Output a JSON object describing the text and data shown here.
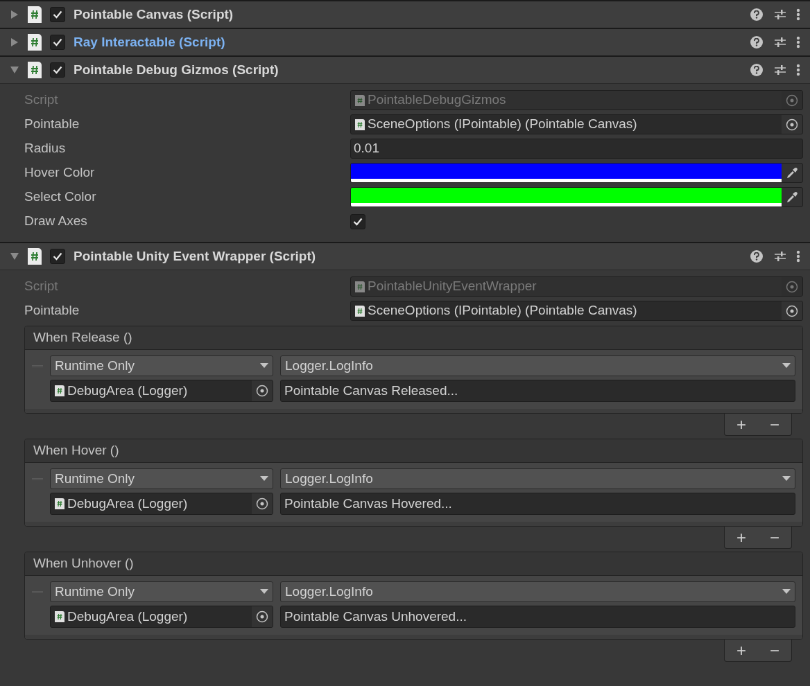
{
  "components": [
    {
      "title": "Pointable Canvas (Script)",
      "expanded": false,
      "enabled": true,
      "highlighted": false
    },
    {
      "title": "Ray Interactable (Script)",
      "expanded": false,
      "enabled": true,
      "highlighted": true
    },
    {
      "title": "Pointable Debug Gizmos (Script)",
      "expanded": true,
      "enabled": true,
      "highlighted": false,
      "fields": [
        {
          "label": "Script",
          "kind": "object",
          "value": "PointableDebugGizmos",
          "disabled": true
        },
        {
          "label": "Pointable",
          "kind": "object",
          "value": "SceneOptions (IPointable) (Pointable Canvas)",
          "disabled": false
        },
        {
          "label": "Radius",
          "kind": "text",
          "value": "0.01",
          "disabled": false
        },
        {
          "label": "Hover Color",
          "kind": "color",
          "color": "#0000ff",
          "disabled": false
        },
        {
          "label": "Select Color",
          "kind": "color",
          "color": "#00ff00",
          "disabled": false
        },
        {
          "label": "Draw Axes",
          "kind": "checkbox",
          "checked": true,
          "disabled": false
        }
      ]
    },
    {
      "title": "Pointable Unity Event Wrapper (Script)",
      "expanded": true,
      "enabled": true,
      "highlighted": false,
      "fields": [
        {
          "label": "Script",
          "kind": "object",
          "value": "PointableUnityEventWrapper",
          "disabled": true
        },
        {
          "label": "Pointable",
          "kind": "object",
          "value": "SceneOptions (IPointable) (Pointable Canvas)",
          "disabled": false
        }
      ],
      "events": [
        {
          "title": "When Release ()",
          "mode": "Runtime Only",
          "function": "Logger.LogInfo",
          "target": "DebugArea (Logger)",
          "argument": "Pointable Canvas Released...",
          "add": "+",
          "remove": "−"
        },
        {
          "title": "When Hover ()",
          "mode": "Runtime Only",
          "function": "Logger.LogInfo",
          "target": "DebugArea (Logger)",
          "argument": "Pointable Canvas Hovered...",
          "add": "+",
          "remove": "−"
        },
        {
          "title": "When Unhover ()",
          "mode": "Runtime Only",
          "function": "Logger.LogInfo",
          "target": "DebugArea (Logger)",
          "argument": "Pointable Canvas Unhovered...",
          "add": "+",
          "remove": "−"
        }
      ]
    }
  ]
}
